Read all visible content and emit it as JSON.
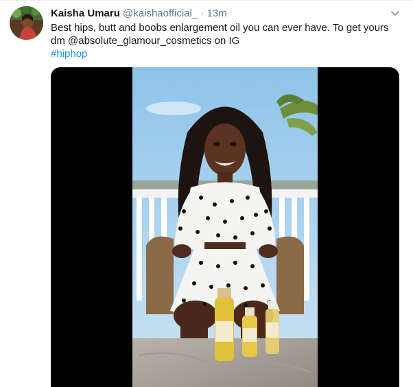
{
  "tweet": {
    "display_name": "Kaisha Umaru",
    "handle": "@kaishaofficial_",
    "separator": "·",
    "time": "13m",
    "text_lines": [
      "Best hips, butt and boobs enlargement oil you can ever have. To get yours",
      "dm @absolute_glamour_cosmetics on IG"
    ],
    "hashtag": "#hiphop"
  },
  "icons": {
    "menu": "chevron-down-icon",
    "avatar": "avatar-photo"
  },
  "colors": {
    "name": "#14171a",
    "secondary": "#657786",
    "link": "#1b95e0",
    "media_background": "#000000"
  }
}
